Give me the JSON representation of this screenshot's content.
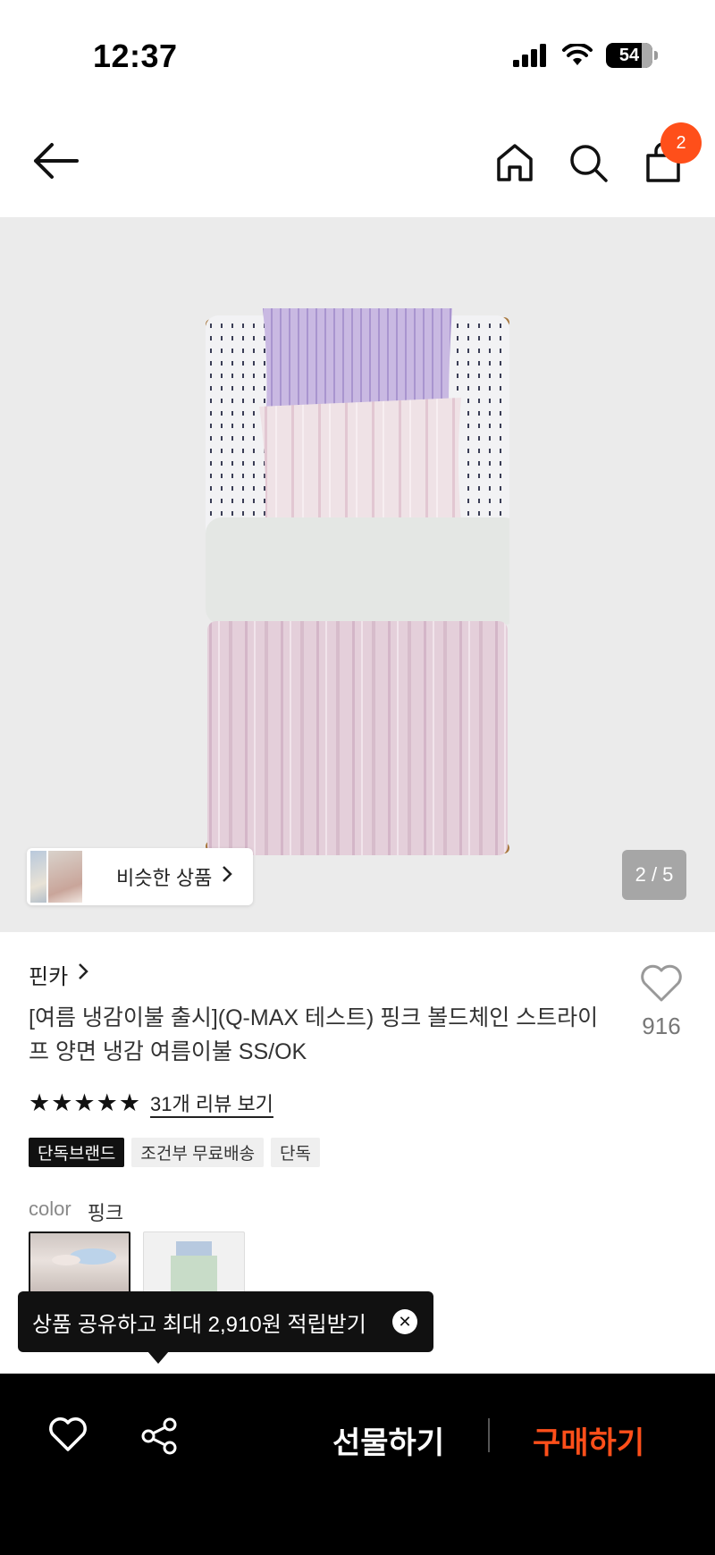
{
  "status_bar": {
    "time": "12:37",
    "battery": "54"
  },
  "nav": {
    "cart_count": "2",
    "icons": [
      "back-arrow-icon",
      "home-icon",
      "search-icon",
      "shopping-bag-icon"
    ]
  },
  "gallery": {
    "similar_label": "비슷한 상품",
    "page_counter": "2 / 5"
  },
  "product": {
    "brand": "핀카",
    "title": "[여름 냉감이불 출시](Q-MAX 테스트) 핑크 볼드체인 스트라이프 양면 냉감 여름이불 SS/OK",
    "like_count": "916",
    "rating_stars": "★★★★★",
    "review_link": "31개 리뷰 보기",
    "badges": [
      "단독브랜드",
      "조건부 무료배송",
      "단독"
    ],
    "color_label": "color",
    "color_value": "핑크"
  },
  "tooltip": {
    "text": "상품 공유하고 최대 2,910원 적립받기"
  },
  "bottom_bar": {
    "gift_label": "선물하기",
    "buy_label": "구매하기"
  },
  "colors": {
    "accent": "#ff4f1a",
    "image_bg": "#ebebeb"
  }
}
